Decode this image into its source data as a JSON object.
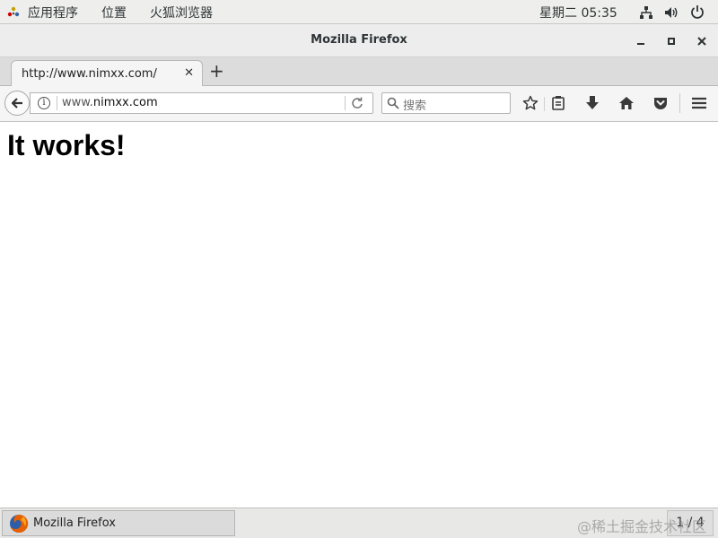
{
  "top_panel": {
    "menus": [
      "应用程序",
      "位置",
      "火狐浏览器"
    ],
    "clock": "星期二 05:35",
    "icons": [
      "network-icon",
      "volume-icon",
      "power-icon"
    ]
  },
  "window": {
    "title": "Mozilla Firefox",
    "controls": {
      "minimize": "minimize-icon",
      "maximize": "maximize-icon",
      "close": "close-icon"
    }
  },
  "tabs": [
    {
      "label": "http://www.nimxx.com/",
      "active": true
    }
  ],
  "navbar": {
    "url_prefix": "www.",
    "url_domain": "nimxx.com",
    "search_placeholder": "搜索",
    "icons": [
      "back-arrow-icon",
      "info-icon",
      "reload-icon",
      "search-icon",
      "bookmark-star-icon",
      "reading-list-icon",
      "download-icon",
      "home-icon",
      "pocket-icon",
      "hamburger-menu-icon"
    ]
  },
  "page": {
    "heading": "It works!"
  },
  "taskbar": {
    "window_label": "Mozilla Firefox",
    "workspace": "1 / 4"
  },
  "watermark": "@稀土掘金技术社区",
  "colors": {
    "panel_bg": "#eeeeec",
    "tabstrip_bg": "#dcdcdc",
    "content_bg": "#ffffff",
    "firefox_orange": "#e66000"
  }
}
